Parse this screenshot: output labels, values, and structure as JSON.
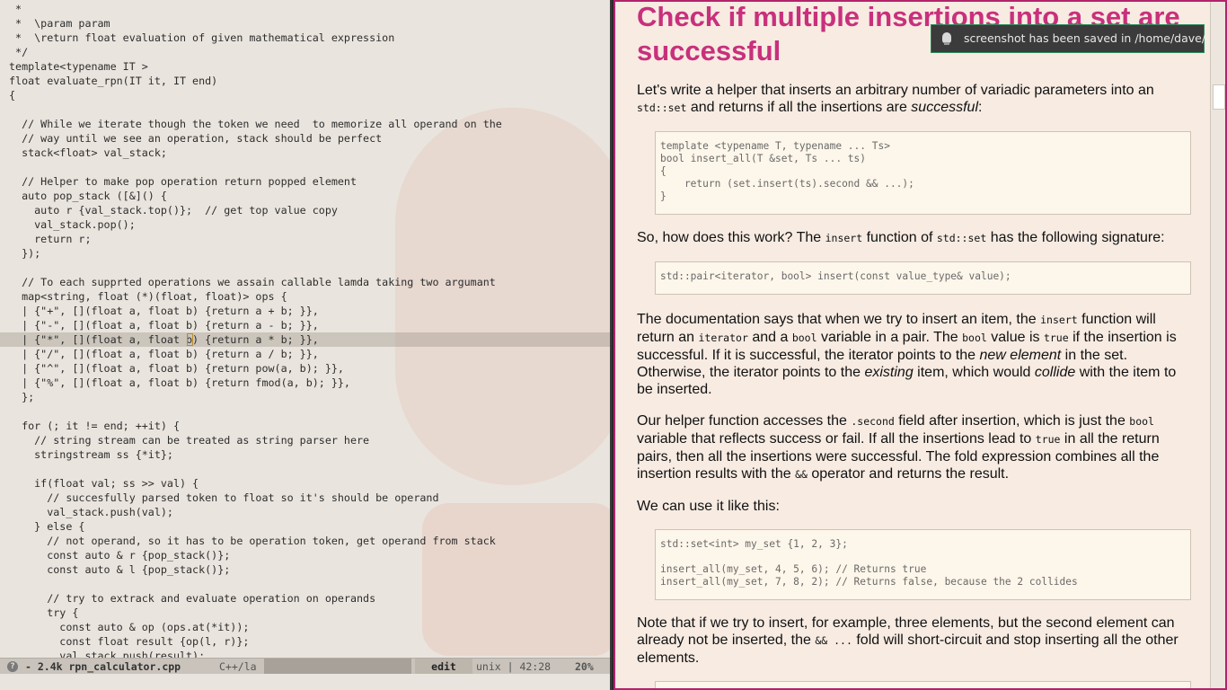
{
  "editor": {
    "lines": [
      " *",
      " *  \\param param",
      " *  \\return float evaluation of given mathematical expression",
      " */",
      "template<typename IT >",
      "float evaluate_rpn(IT it, IT end)",
      "{",
      "",
      "  // While we iterate though the token we need  to memorize all operand on the",
      "  // way until we see an operation, stack should be perfect",
      "  stack<float> val_stack;",
      "",
      "  // Helper to make pop operation return popped element",
      "  auto pop_stack ([&]() {",
      "    auto r {val_stack.top()};  // get top value copy",
      "    val_stack.pop();",
      "    return r;",
      "  });",
      "",
      "  // To each supprted operations we assain callable lamda taking two argumant",
      "  map<string, float (*)(float, float)> ops {",
      "  | {\"+\", [](float a, float b) {return a + b; }},",
      "  | {\"-\", [](float a, float b) {return a - b; }},",
      "  | {\"*\", [](float a, float b) {return a * b; }},",
      "  | {\"/\", [](float a, float b) {return a / b; }},",
      "  | {\"^\", [](float a, float b) {return pow(a, b); }},",
      "  | {\"%\", [](float a, float b) {return fmod(a, b); }},",
      "  };",
      "",
      "  for (; it != end; ++it) {",
      "    // string stream can be treated as string parser here",
      "    stringstream ss {*it};",
      "",
      "    if(float val; ss >> val) {",
      "      // succesfully parsed token to float so it's should be operand",
      "      val_stack.push(val);",
      "    } else {",
      "      // not operand, so it has to be operation token, get operand from stack",
      "      const auto & r {pop_stack()};",
      "      const auto & l {pop_stack()};",
      "",
      "      // try to extrack and evaluate operation on operands",
      "      try {",
      "        const auto & op (ops.at(*it));",
      "        const float result {op(l, r)};",
      "        val_stack.push(result);"
    ],
    "highlight_line": 23,
    "modeline": {
      "indicator": "?",
      "file": "- 2.4k rpn_calculator.cpp",
      "mode": "C++/la",
      "state": "edit",
      "position": "unix | 42:28",
      "percent": "20%"
    }
  },
  "browser": {
    "title": "Check if multiple insertions into a set are successful",
    "p1_pre": "Let's write a helper that inserts an arbitrary number of variadic parameters into an ",
    "p1_code": "std::set",
    "p1_mid": " and returns if all the insertions are ",
    "p1_em": "successful",
    "p1_end": ":",
    "code1": [
      "template <typename T, typename ... Ts>",
      "bool insert_all(T &set, Ts ... ts)",
      "{",
      "    return (set.insert(ts).second && ...);",
      "}"
    ],
    "p2_pre": "So, how does this work? The ",
    "p2_code1": "insert",
    "p2_mid": " function of ",
    "p2_code2": "std::set",
    "p2_end": " has the following signature:",
    "code2": [
      "std::pair<iterator, bool> insert(const value_type& value);"
    ],
    "p3": {
      "a": "The documentation says that when we try to insert an item, the ",
      "b": "insert",
      "c": " function will return an ",
      "d": "iterator",
      "e": " and a ",
      "f": "bool",
      "g": " variable in a pair. The ",
      "h": "bool",
      "i": " value is ",
      "j": "true",
      "k": " if the insertion is successful. If it is successful, the iterator points to the ",
      "l": "new element",
      "m": " in the set. Otherwise, the iterator points to the ",
      "n": "existing",
      "o": " item, which would ",
      "p": "collide",
      "q": " with the item to be inserted."
    },
    "p4": {
      "a": "Our helper function accesses the ",
      "b": ".second",
      "c": " field after insertion, which is just the ",
      "d": "bool",
      "e": " variable that reflects success or fail. If all the insertions lead to ",
      "f": "true",
      "g": " in all the return pairs, then all the insertions were successful. The fold expression combines all the insertion results with the ",
      "h": "&&",
      "i": " operator and returns the result."
    },
    "p5": "We can use it like this:",
    "code3": [
      "std::set<int> my_set {1, 2, 3};",
      "",
      "insert_all(my_set, 4, 5, 6); // Returns true",
      "insert_all(my_set, 7, 8, 2); // Returns false, because the 2 collides"
    ],
    "p6": {
      "a": "Note that if we try to insert, for example, three elements, but the second element can already not be inserted, the ",
      "b": "&& ...",
      "c": " fold will short-circuit and stop inserting all the other elements."
    }
  },
  "notification": {
    "text": "screenshot has been saved in /home/dave/",
    "icon": "lightbulb-icon"
  },
  "colors": {
    "heading": "#c8307c",
    "window_border": "#b3236b",
    "notification_border": "#2a8a5a"
  }
}
